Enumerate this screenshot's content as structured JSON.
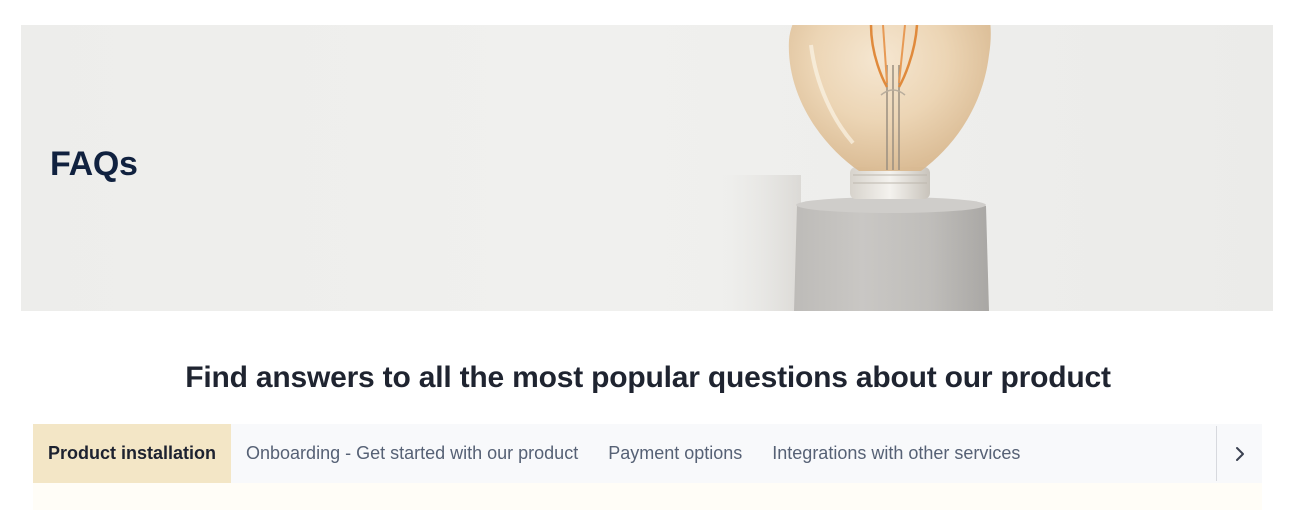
{
  "hero": {
    "title": "FAQs"
  },
  "main": {
    "heading": "Find answers to all the most popular questions about our product"
  },
  "tabs": [
    {
      "label": "Product installation",
      "active": true
    },
    {
      "label": "Onboarding - Get started with our product",
      "active": false
    },
    {
      "label": "Payment options",
      "active": false
    },
    {
      "label": "Integrations with other services",
      "active": false
    }
  ],
  "colors": {
    "title": "#10213f",
    "active_tab_bg": "#f3e6c6",
    "tabbar_bg": "#f8f9fb"
  },
  "icons": {
    "scroll_next": "chevron-right-icon",
    "hero_image": "light-bulb-image"
  }
}
